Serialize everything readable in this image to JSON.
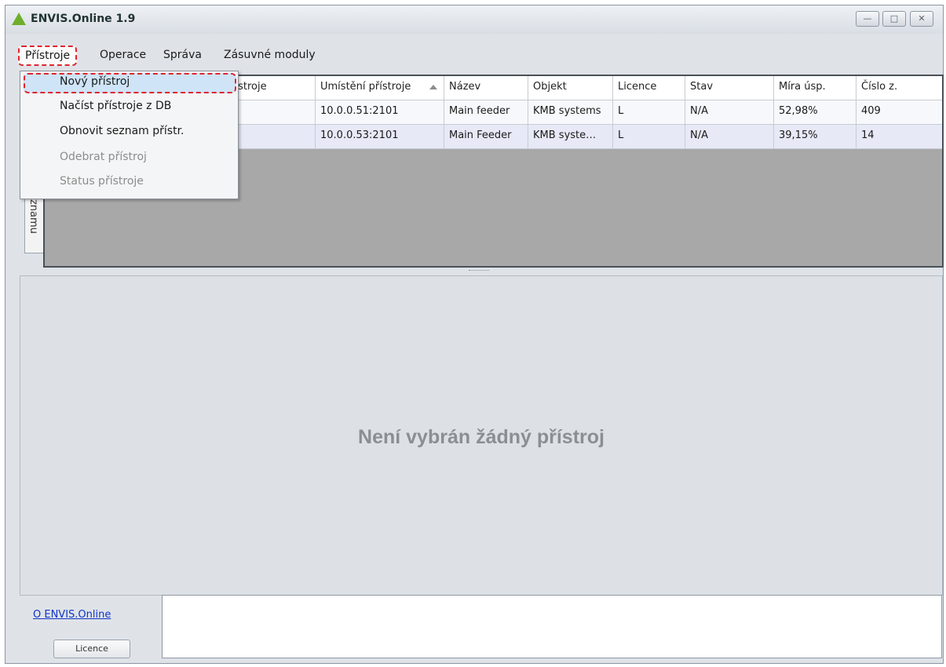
{
  "window": {
    "title": "ENVIS.Online 1.9",
    "controls": {
      "minimize": "—",
      "maximize": "□",
      "close": "✕"
    }
  },
  "menubar": {
    "items": [
      "Přístroje",
      "Operace",
      "Správa",
      "Zásuvné moduly"
    ]
  },
  "dropdown": {
    "items": [
      {
        "label": "Nový přístroj",
        "enabled": true,
        "highlighted": true
      },
      {
        "label": "Načíst přístroje z DB",
        "enabled": true
      },
      {
        "label": "Obnovit seznam přístr.",
        "enabled": true
      },
      {
        "label": "Odebrat přístroj",
        "enabled": false
      },
      {
        "label": "Status přístroje",
        "enabled": false
      }
    ]
  },
  "side_tab": {
    "label": "áznamu"
  },
  "grid": {
    "columns": [
      "esa přístroje",
      "Umístění přístroje",
      "Název",
      "Objekt",
      "Licence",
      "Stav",
      "Míra úsp.",
      "Číslo z."
    ],
    "sorted_column": "Umístění přístroje",
    "rows": [
      [
        "",
        "10.0.0.51:2101",
        "Main feeder",
        "KMB systems",
        "L",
        "N/A",
        "52,98%",
        "409"
      ],
      [
        "",
        "10.0.0.53:2101",
        "Main Feeder",
        "KMB syste…",
        "L",
        "N/A",
        "39,15%",
        "14"
      ]
    ]
  },
  "detail": {
    "empty_message": "Není vybrán žádný přístroj"
  },
  "footer": {
    "about_link": "O ENVIS.Online",
    "licence_button": "Licence"
  },
  "colors": {
    "accent_highlight": "#e0242f",
    "selection": "#cfe4f7",
    "grid_background": "#a8a8a8"
  }
}
